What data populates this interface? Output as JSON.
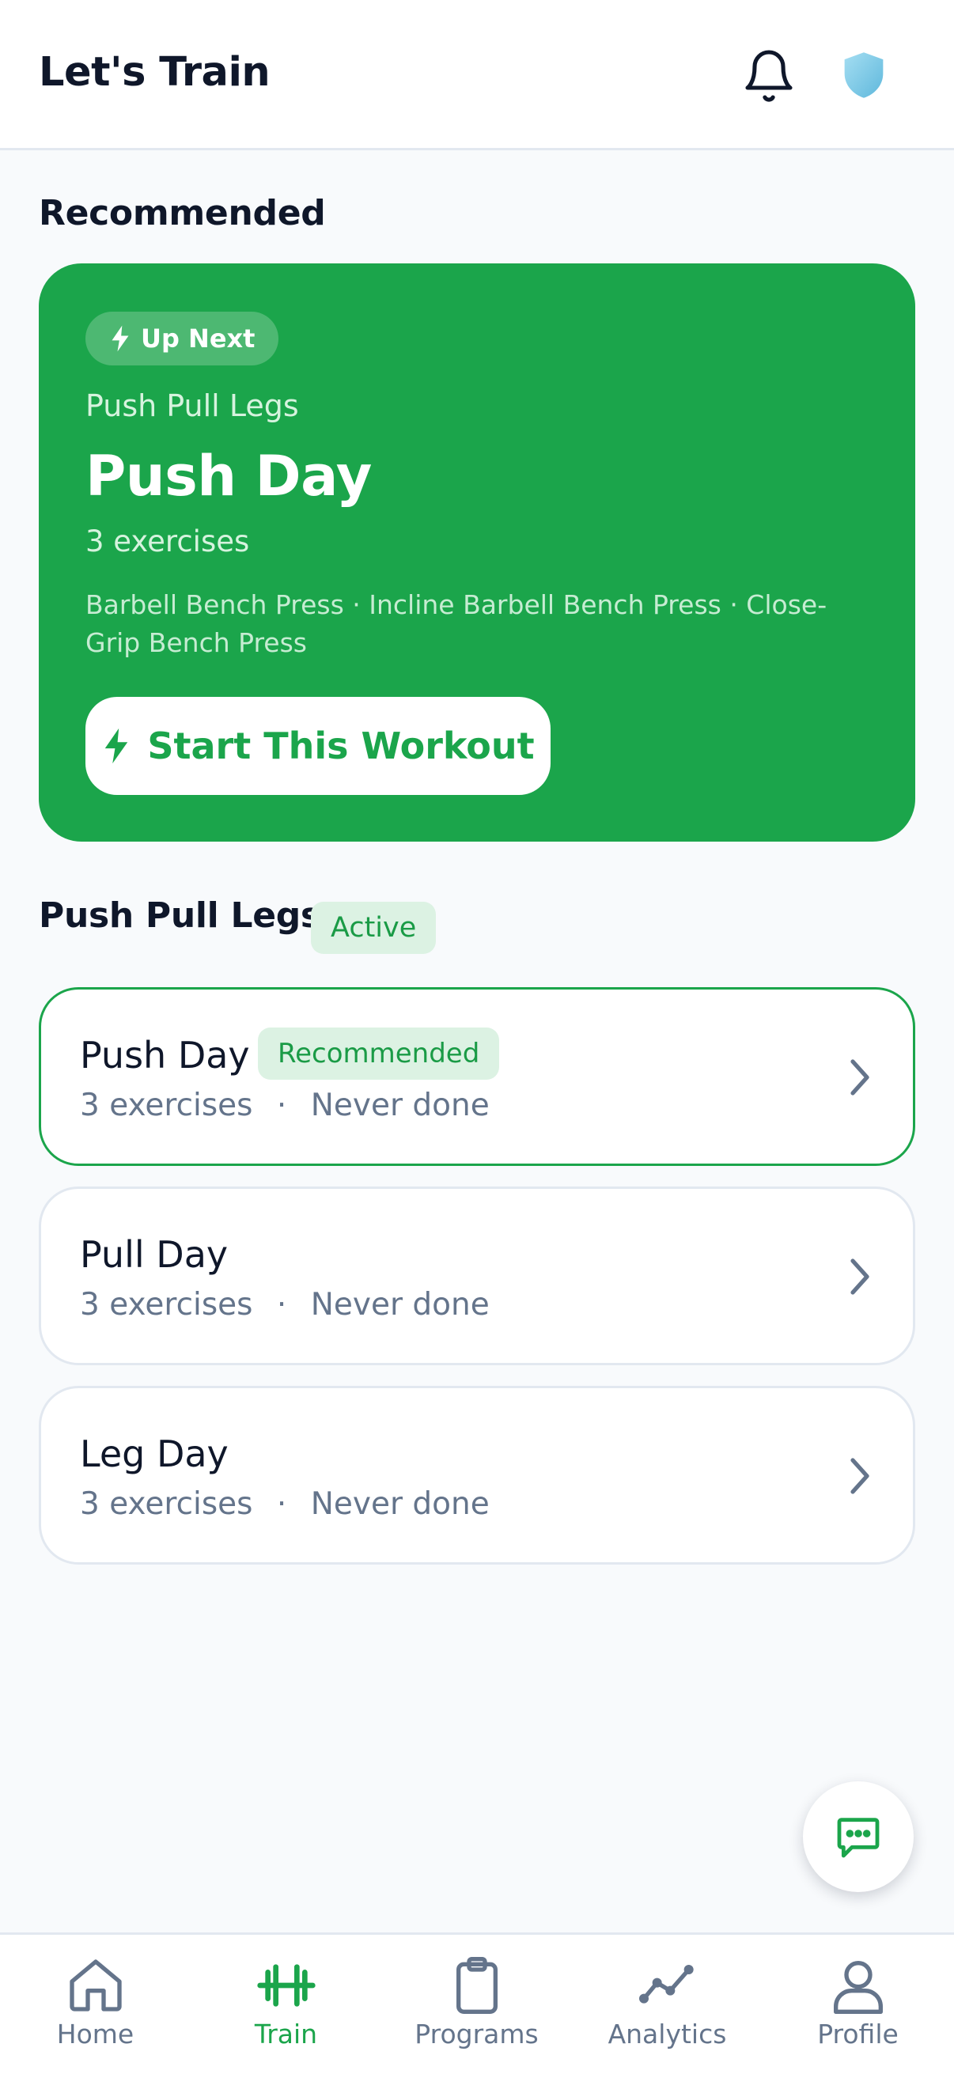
{
  "header": {
    "title": "Let's Train"
  },
  "recommended": {
    "section_title": "Recommended",
    "badge": "Up Next",
    "program": "Push Pull Legs",
    "day": "Push Day",
    "exercise_count": "3 exercises",
    "exercise_list": "Barbell Bench Press · Incline Barbell Bench Press · Close-Grip Bench Press",
    "start_button": "Start This Workout"
  },
  "program": {
    "title": "Push Pull Legs",
    "status_badge": "Active",
    "days": [
      {
        "name": "Push Day",
        "badge": "Recommended",
        "exercises": "3 exercises",
        "separator": "·",
        "last_done": "Never done"
      },
      {
        "name": "Pull Day",
        "exercises": "3 exercises",
        "separator": "·",
        "last_done": "Never done"
      },
      {
        "name": "Leg Day",
        "exercises": "3 exercises",
        "separator": "·",
        "last_done": "Never done"
      }
    ]
  },
  "nav": {
    "items": [
      {
        "label": "Home",
        "icon": "home-icon"
      },
      {
        "label": "Train",
        "icon": "dumbbell-icon",
        "active": true
      },
      {
        "label": "Programs",
        "icon": "clipboard-icon"
      },
      {
        "label": "Analytics",
        "icon": "line-chart-icon"
      },
      {
        "label": "Profile",
        "icon": "user-icon"
      }
    ]
  },
  "colors": {
    "accent": "#1ba54b",
    "accent_light": "#dcf2e3",
    "text": "#0f172a",
    "muted": "#64748b",
    "background": "#f8fafc"
  }
}
